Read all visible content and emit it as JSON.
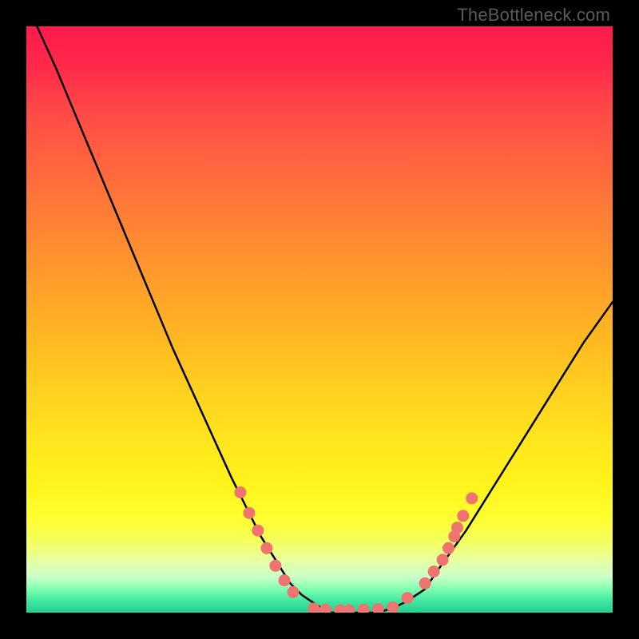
{
  "watermark": "TheBottleneck.com",
  "colors": {
    "frame": "#000000",
    "curve": "#000000",
    "marker": "#ef7470",
    "gradient_top": "#ff1a4d",
    "gradient_bottom": "#20d090"
  },
  "chart_data": {
    "type": "line",
    "title": "",
    "xlabel": "",
    "ylabel": "",
    "xlim": [
      0,
      100
    ],
    "ylim": [
      0,
      100
    ],
    "x": [
      0,
      5,
      10,
      15,
      20,
      25,
      30,
      35,
      40,
      45,
      47,
      50,
      52,
      55,
      58,
      60,
      63,
      65,
      68,
      70,
      75,
      80,
      85,
      90,
      95,
      100
    ],
    "values": [
      104,
      93,
      81,
      69,
      57,
      45,
      34,
      23,
      13,
      5,
      3,
      1,
      0,
      0,
      0,
      0,
      1,
      2,
      4,
      7,
      14,
      22,
      30,
      38,
      46,
      53
    ],
    "notes": "V-shaped bottleneck curve plotted over a vertical traffic-light gradient (red high, green low). Flat minimum region roughly x=50..62. Salmon dot markers cluster near the bottom of the V on both sides and along the flat trough."
  },
  "markers": {
    "points": [
      {
        "x": 36.5,
        "y": 20.5
      },
      {
        "x": 38.0,
        "y": 17.0
      },
      {
        "x": 39.5,
        "y": 14.0
      },
      {
        "x": 41.0,
        "y": 11.0
      },
      {
        "x": 42.5,
        "y": 8.0
      },
      {
        "x": 44.0,
        "y": 5.5
      },
      {
        "x": 45.5,
        "y": 3.5
      },
      {
        "x": 49.0,
        "y": 0.7
      },
      {
        "x": 51.0,
        "y": 0.5
      },
      {
        "x": 53.5,
        "y": 0.4
      },
      {
        "x": 55.0,
        "y": 0.4
      },
      {
        "x": 57.5,
        "y": 0.5
      },
      {
        "x": 60.0,
        "y": 0.6
      },
      {
        "x": 62.5,
        "y": 0.9
      },
      {
        "x": 65.0,
        "y": 2.5
      },
      {
        "x": 68.0,
        "y": 5.0
      },
      {
        "x": 69.5,
        "y": 7.0
      },
      {
        "x": 71.0,
        "y": 9.0
      },
      {
        "x": 72.0,
        "y": 11.0
      },
      {
        "x": 73.0,
        "y": 13.0
      },
      {
        "x": 73.5,
        "y": 14.5
      },
      {
        "x": 74.5,
        "y": 16.5
      },
      {
        "x": 76.0,
        "y": 19.5
      }
    ]
  }
}
